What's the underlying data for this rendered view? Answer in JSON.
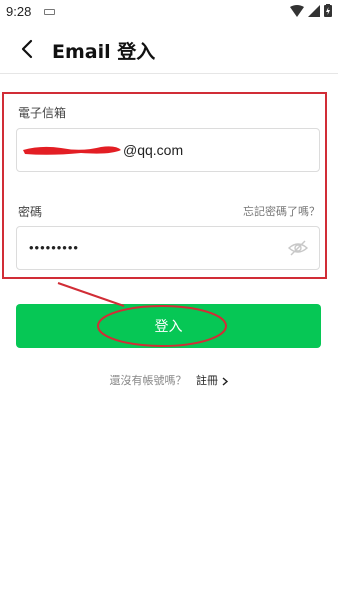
{
  "status_bar": {
    "time": "9:28"
  },
  "header": {
    "back_icon": "chevron-left-icon",
    "title": "Email 登入"
  },
  "form": {
    "email_label": "電子信箱",
    "email_value": "@qq.com",
    "password_label": "密碼",
    "forgot_password": "忘記密碼了嗎？",
    "password_value": "•••••••••",
    "eye_icon": "eye-off-icon"
  },
  "login_button": {
    "label": "登入",
    "color": "#06c755"
  },
  "footer": {
    "prompt": "還沒有帳號嗎？",
    "register_label": "註冊"
  },
  "colors": {
    "annotation": "#d12d36",
    "redaction": "#e31e24"
  }
}
